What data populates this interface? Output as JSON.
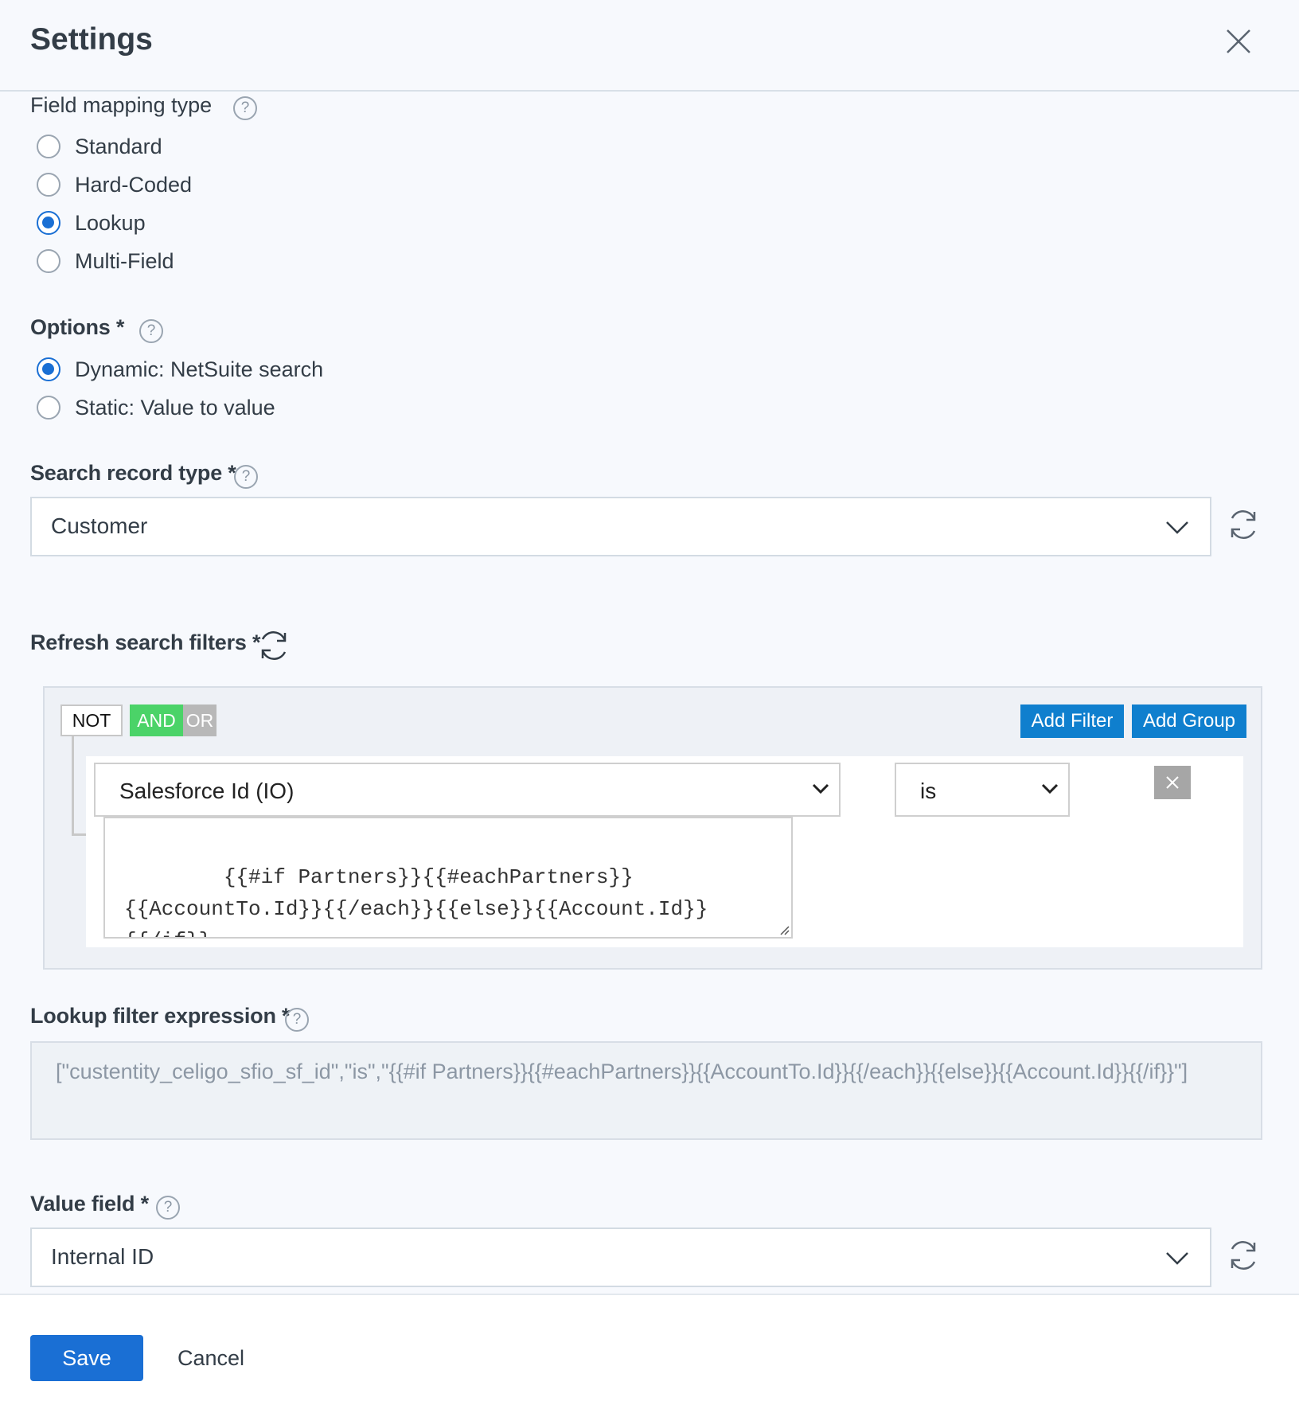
{
  "dialog": {
    "title": "Settings"
  },
  "mapping_type": {
    "label": "Field mapping type",
    "help": "?",
    "options": [
      {
        "label": "Standard",
        "checked": false
      },
      {
        "label": "Hard-Coded",
        "checked": false
      },
      {
        "label": "Lookup",
        "checked": true
      },
      {
        "label": "Multi-Field",
        "checked": false
      }
    ]
  },
  "options": {
    "label": "Options *",
    "help": "?",
    "items": [
      {
        "label": "Dynamic: NetSuite search",
        "checked": true
      },
      {
        "label": "Static: Value to value",
        "checked": false
      }
    ]
  },
  "search_record_type": {
    "label": "Search record type *",
    "help": "?",
    "value": "Customer"
  },
  "refresh_filters": {
    "label": "Refresh search filters *"
  },
  "filter_builder": {
    "not_label": "NOT",
    "and_label": "AND",
    "or_label": "OR",
    "add_filter": "Add Filter",
    "add_group": "Add Group",
    "rule": {
      "field": "Salesforce Id (IO)",
      "operator": "is",
      "value": "{{#if Partners}}{{#eachPartners}}\n{{AccountTo.Id}}{{/each}}{{else}}{{Account.Id}}\n{{/if}}"
    }
  },
  "lookup_expression": {
    "label": "Lookup filter expression *",
    "help": "?",
    "value": "[\"custentity_celigo_sfio_sf_id\",\"is\",\"{{#if Partners}}{{#eachPartners}}{{AccountTo.Id}}{{/each}}{{else}}{{Account.Id}}{{/if}}\"]"
  },
  "value_field": {
    "label": "Value field *",
    "help": "?",
    "value": "Internal ID"
  },
  "footer": {
    "save": "Save",
    "cancel": "Cancel"
  },
  "colors": {
    "primary": "#1a6fd4",
    "and_active": "#4bd368",
    "or_inactive": "#b8b8b8",
    "action_blue": "#0f7fce"
  }
}
